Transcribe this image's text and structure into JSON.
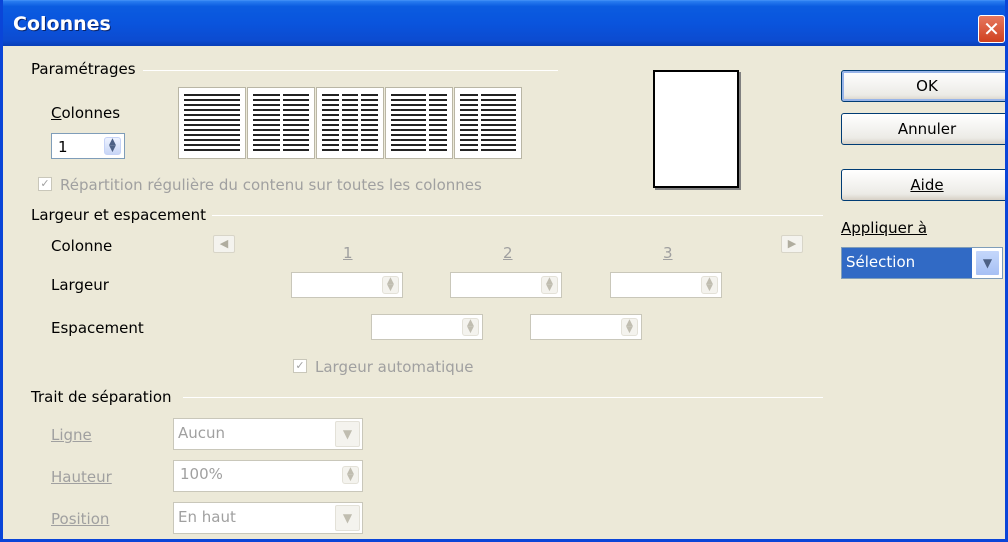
{
  "window": {
    "title": "Colonnes",
    "close_icon": "close-icon"
  },
  "settings": {
    "section_label": "Paramétrages",
    "columns_label": "Colonnes",
    "columns_value": "1",
    "presets": [
      {
        "name": "1 colonne",
        "cols": 1
      },
      {
        "name": "2 colonnes",
        "cols": 2
      },
      {
        "name": "3 colonnes",
        "cols": 3
      },
      {
        "name": "2 colonnes gauche large",
        "cols": 2
      },
      {
        "name": "2 colonnes droite large",
        "cols": 2
      }
    ],
    "even_distribution_label": "Répartition régulière du contenu sur toutes les colonnes",
    "even_distribution_checked": true
  },
  "width_spacing": {
    "section_label": "Largeur et espacement",
    "column_label": "Colonne",
    "column_numbers": [
      "1",
      "2",
      "3"
    ],
    "width_label": "Largeur",
    "spacing_label": "Espacement",
    "auto_width_label": "Largeur automatique",
    "auto_width_checked": true
  },
  "separator": {
    "section_label": "Trait de séparation",
    "line_label": "Ligne",
    "line_value": "Aucun",
    "height_label": "Hauteur",
    "height_value": "100%",
    "position_label": "Position",
    "position_value": "En haut"
  },
  "buttons": {
    "ok": "OK",
    "cancel": "Annuler",
    "help": "Aide"
  },
  "apply_to": {
    "label": "Appliquer à",
    "value": "Sélection"
  }
}
